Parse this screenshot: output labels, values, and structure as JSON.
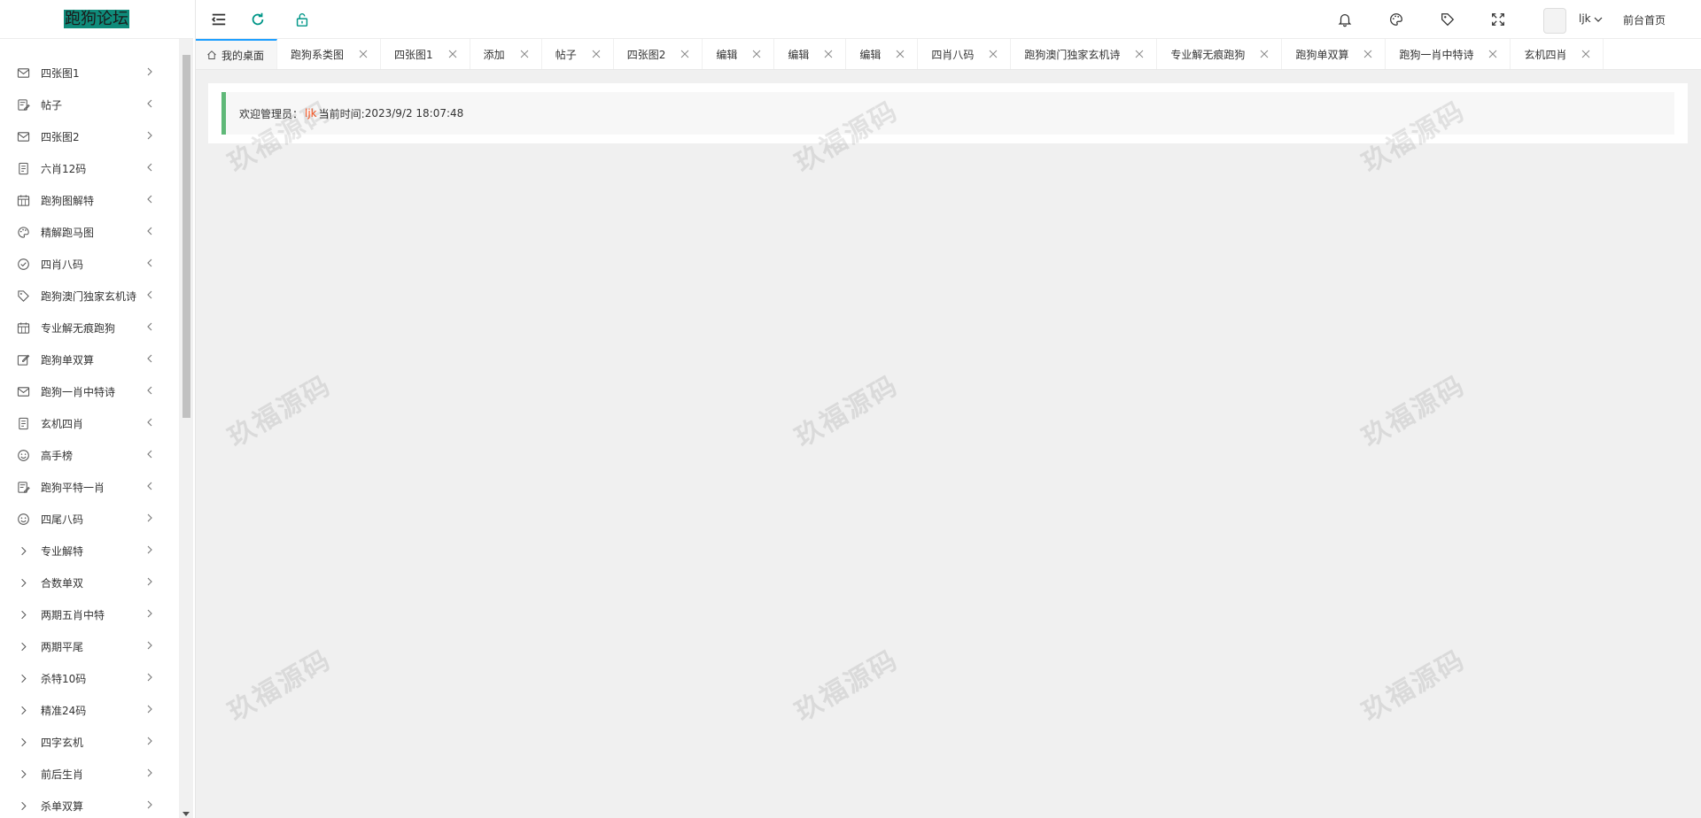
{
  "app": {
    "logo_text": "跑狗论坛"
  },
  "sidebar": {
    "items": [
      {
        "label": "四张图1",
        "icon": "mail-icon",
        "arrow": "right"
      },
      {
        "label": "帖子",
        "icon": "edit-note-icon",
        "arrow": "left"
      },
      {
        "label": "四张图2",
        "icon": "mail-icon",
        "arrow": "right"
      },
      {
        "label": "六肖12码",
        "icon": "notebook-icon",
        "arrow": "left"
      },
      {
        "label": "跑狗图解特",
        "icon": "calendar-icon",
        "arrow": "left"
      },
      {
        "label": "精解跑马图",
        "icon": "palette-icon",
        "arrow": "left"
      },
      {
        "label": "四肖八码",
        "icon": "check-circle-icon",
        "arrow": "left"
      },
      {
        "label": "跑狗澳门独家玄机诗",
        "icon": "tag-icon",
        "arrow": "left"
      },
      {
        "label": "专业解无痕跑狗",
        "icon": "calendar-icon",
        "arrow": "left"
      },
      {
        "label": "跑狗单双算",
        "icon": "edit-icon",
        "arrow": "left"
      },
      {
        "label": "跑狗一肖中特诗",
        "icon": "mail-icon",
        "arrow": "left"
      },
      {
        "label": "玄机四肖",
        "icon": "notebook-icon",
        "arrow": "left"
      },
      {
        "label": "高手榜",
        "icon": "smile-icon",
        "arrow": "left"
      },
      {
        "label": "跑狗平特一肖",
        "icon": "edit-note-icon",
        "arrow": "left"
      },
      {
        "label": "四尾八码",
        "icon": "smile-icon",
        "arrow": "right"
      },
      {
        "label": "专业解特",
        "icon": "chevron-right-icon",
        "arrow": "right"
      },
      {
        "label": "合数单双",
        "icon": "chevron-right-icon",
        "arrow": "right"
      },
      {
        "label": "两期五肖中特",
        "icon": "chevron-right-icon",
        "arrow": "right"
      },
      {
        "label": "两期平尾",
        "icon": "chevron-right-icon",
        "arrow": "right"
      },
      {
        "label": "杀特10码",
        "icon": "chevron-right-icon",
        "arrow": "right"
      },
      {
        "label": "精准24码",
        "icon": "chevron-right-icon",
        "arrow": "right"
      },
      {
        "label": "四字玄机",
        "icon": "chevron-right-icon",
        "arrow": "right"
      },
      {
        "label": "前后生肖",
        "icon": "chevron-right-icon",
        "arrow": "right"
      },
      {
        "label": "杀单双算",
        "icon": "chevron-right-icon",
        "arrow": "right"
      }
    ]
  },
  "header": {
    "user_name": "ljk",
    "front_link": "前台首页",
    "icons": [
      "menu-toggle-icon",
      "refresh-icon",
      "lock-icon",
      "bell-icon",
      "theme-palette-icon",
      "tag-icon",
      "fullscreen-icon"
    ]
  },
  "tabs": [
    {
      "label": "我的桌面",
      "active": true,
      "home": true
    },
    {
      "label": "跑狗系类图"
    },
    {
      "label": "四张图1"
    },
    {
      "label": "添加"
    },
    {
      "label": "帖子"
    },
    {
      "label": "四张图2"
    },
    {
      "label": "编辑"
    },
    {
      "label": "编辑"
    },
    {
      "label": "编辑"
    },
    {
      "label": "四肖八码"
    },
    {
      "label": "跑狗澳门独家玄机诗"
    },
    {
      "label": "专业解无痕跑狗"
    },
    {
      "label": "跑狗单双算"
    },
    {
      "label": "跑狗一肖中特诗"
    },
    {
      "label": "玄机四肖"
    }
  ],
  "welcome": {
    "prefix": "欢迎管理员：",
    "user": "ljk",
    "time_label": "当前时间:",
    "time_value": "2023/9/2 18:07:48"
  },
  "watermark": {
    "text": "玖福源码"
  },
  "colors": {
    "accent_green": "#5fb878",
    "accent_blue": "#1e9fff",
    "user_highlight": "#ff5722",
    "refresh_green": "#009688",
    "logo_bg": "#0f8b7a"
  }
}
